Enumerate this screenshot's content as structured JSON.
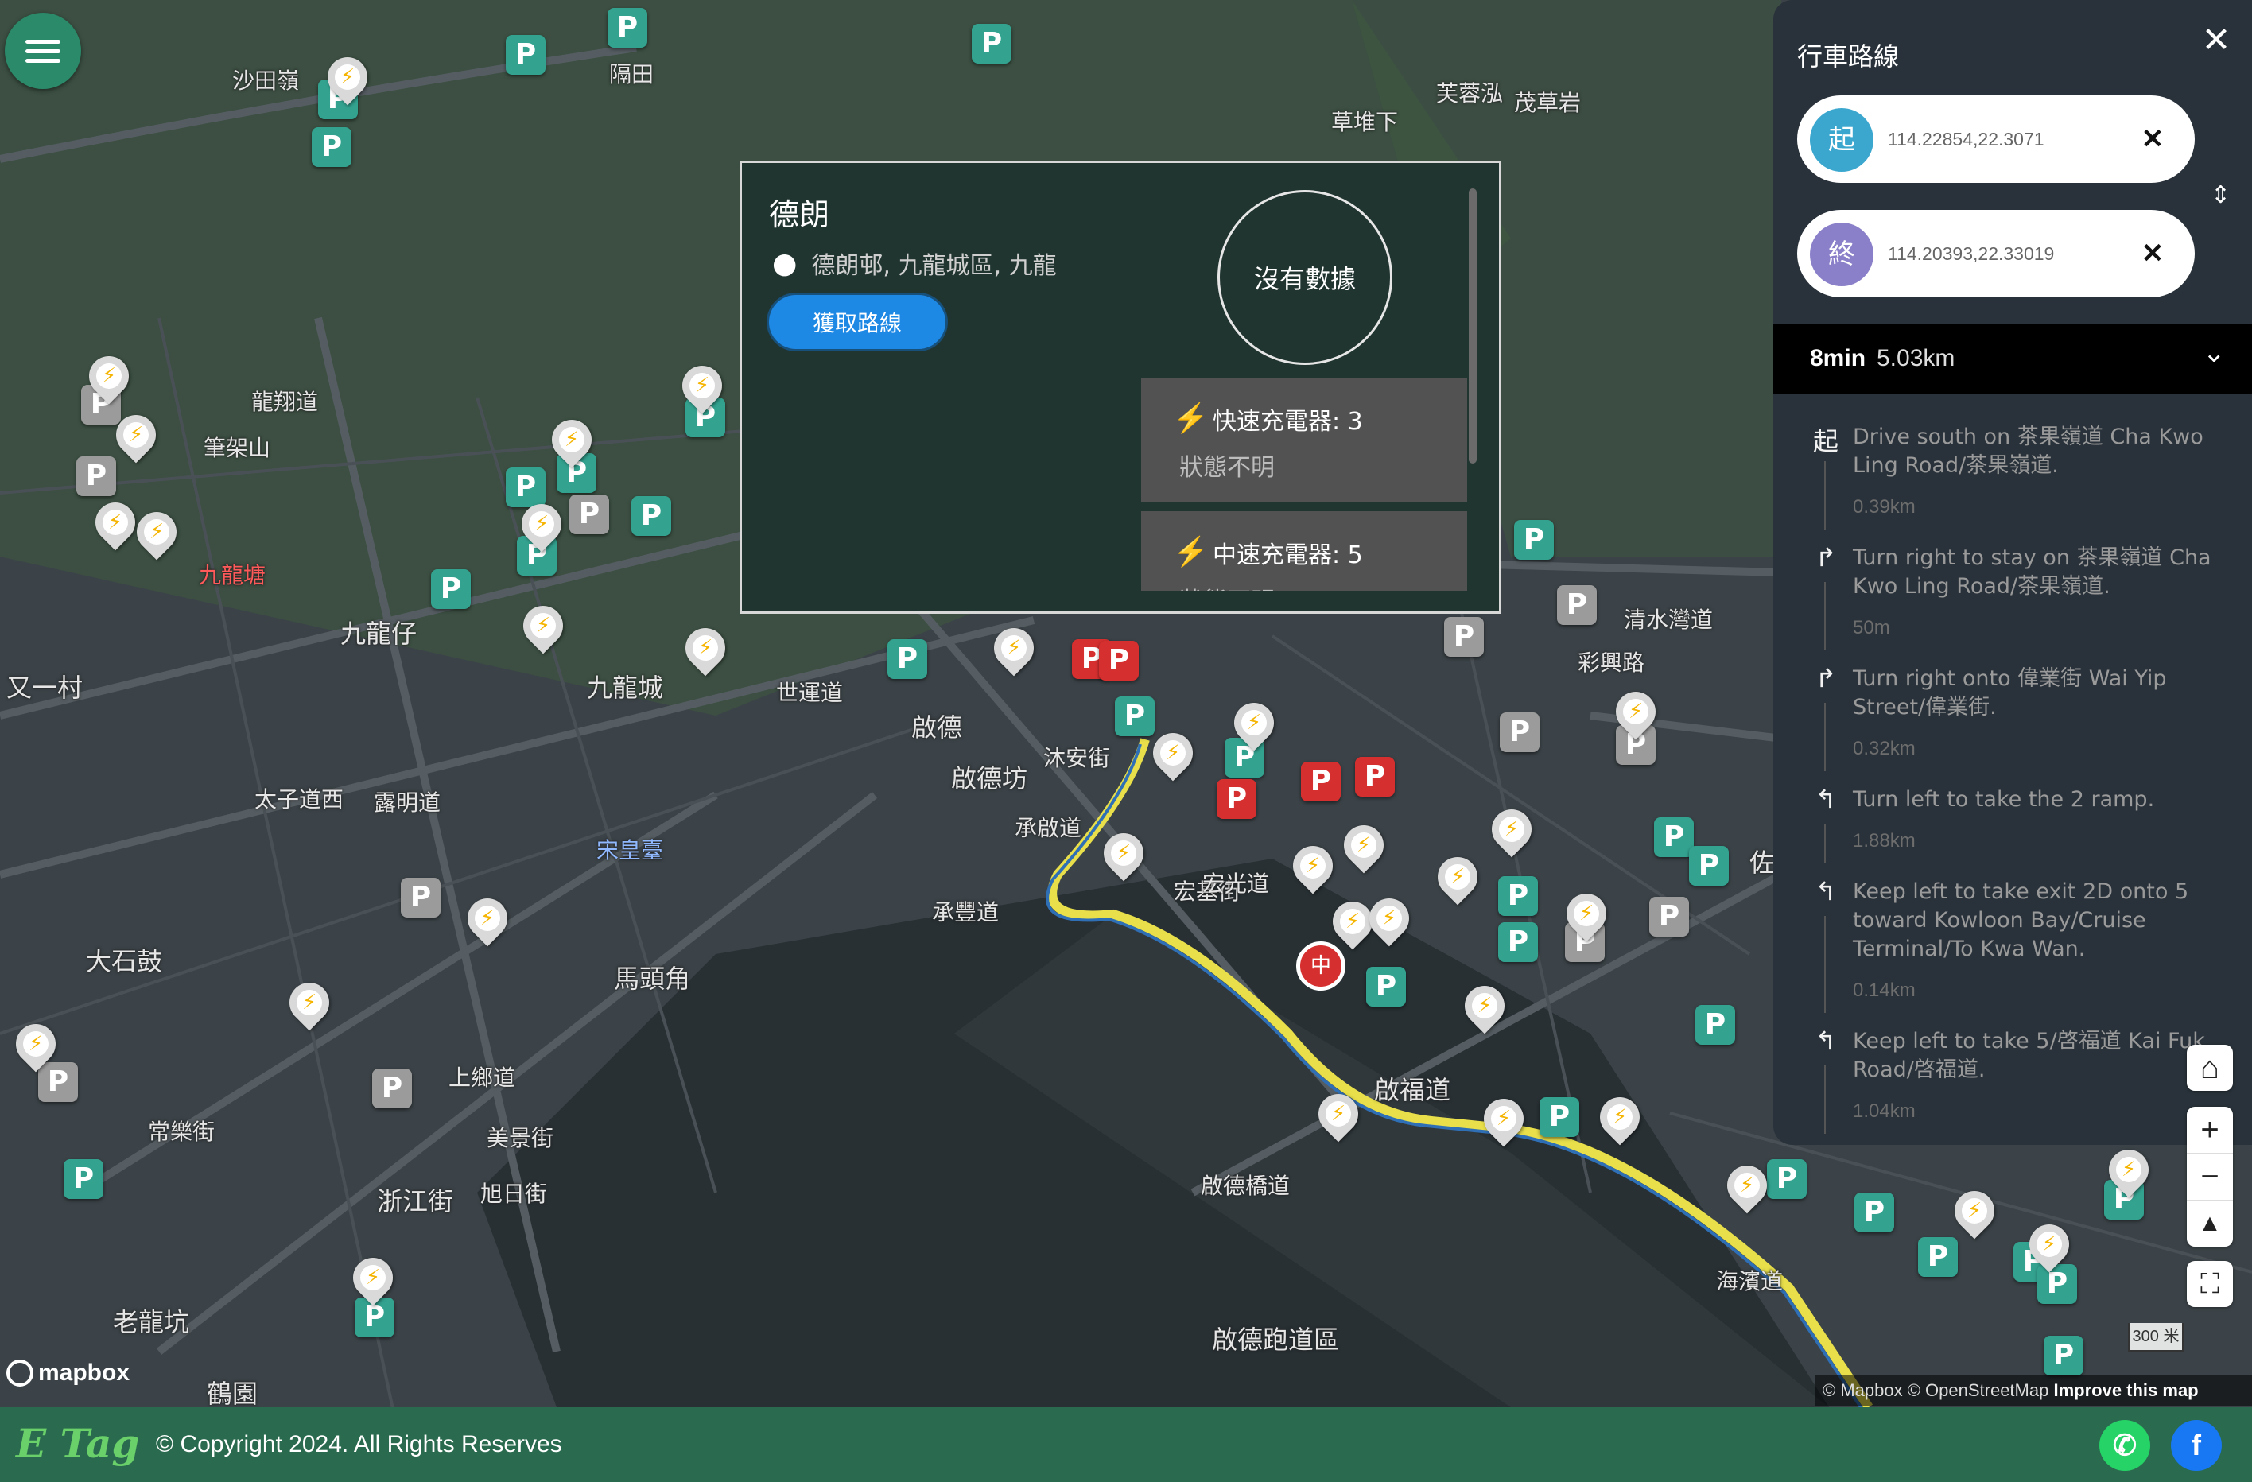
{
  "map": {
    "places": [
      "沙田嶺",
      "隔田",
      "芙蓉泓",
      "茂草岩",
      "草堆下",
      "筆架山",
      "龍翔道",
      "九龍塘",
      "九龍仔",
      "九龍城",
      "又一村",
      "世運道",
      "啟德",
      "啟德坊",
      "沐安街",
      "承啟道",
      "宋皇臺",
      "馬頭角",
      "大石鼓",
      "上鄉道",
      "美景街",
      "浙江街",
      "旭日街",
      "常樂街",
      "老龍坑",
      "鶴園",
      "清水灣道",
      "彩興路",
      "宏基街",
      "宏光道",
      "啟福道",
      "啟德橋道",
      "海濱道",
      "啟德跑道區",
      "承豐道",
      "太子道西",
      "露明道",
      "佐"
    ],
    "attribution": "© Mapbox © OpenStreetMap",
    "improve_link": "Improve this map",
    "mapbox_logo": "mapbox",
    "scale_label": "300 米",
    "accent_route_color": "#e8df4a"
  },
  "popup": {
    "title": "德朗",
    "address": "德朗邨, 九龍城區, 九龍",
    "route_button": "獲取路線",
    "availability": "沒有數據",
    "chargers": [
      {
        "name": "快速充電器: 3",
        "status": "狀態不明"
      },
      {
        "name": "中速充電器: 5",
        "status": "狀態不明"
      }
    ]
  },
  "sidebar": {
    "title": "行車路線",
    "close_icon": "close-icon",
    "origin": {
      "badge": "起",
      "coord": "114.22854,22.3071",
      "color": "#3ba7cf"
    },
    "destination": {
      "badge": "終",
      "coord": "114.20393,22.33019",
      "color": "#8a80c9"
    },
    "summary": {
      "time": "8min",
      "distance": "5.03km"
    },
    "steps": [
      {
        "icon": "起",
        "text": "Drive south on 茶果嶺道 Cha Kwo Ling Road/茶果嶺道.",
        "distance": "0.39km"
      },
      {
        "icon": "↱",
        "text": "Turn right to stay on 茶果嶺道 Cha Kwo Ling Road/茶果嶺道.",
        "distance": "50m"
      },
      {
        "icon": "↱",
        "text": "Turn right onto 偉業街 Wai Yip Street/偉業街.",
        "distance": "0.32km"
      },
      {
        "icon": "↰",
        "text": "Turn left to take the 2 ramp.",
        "distance": "1.88km"
      },
      {
        "icon": "↰",
        "text": "Keep left to take exit 2D onto 5 toward Kowloon Bay/Cruise Terminal/To Kwa Wan.",
        "distance": "0.14km"
      },
      {
        "icon": "↰",
        "text": "Keep left to take 5/啓福道 Kai Fuk Road/啓福道.",
        "distance": "1.04km"
      }
    ]
  },
  "footer": {
    "logo": "E Tag",
    "copyright": "© Copyright 2024. All Rights Reserves"
  }
}
